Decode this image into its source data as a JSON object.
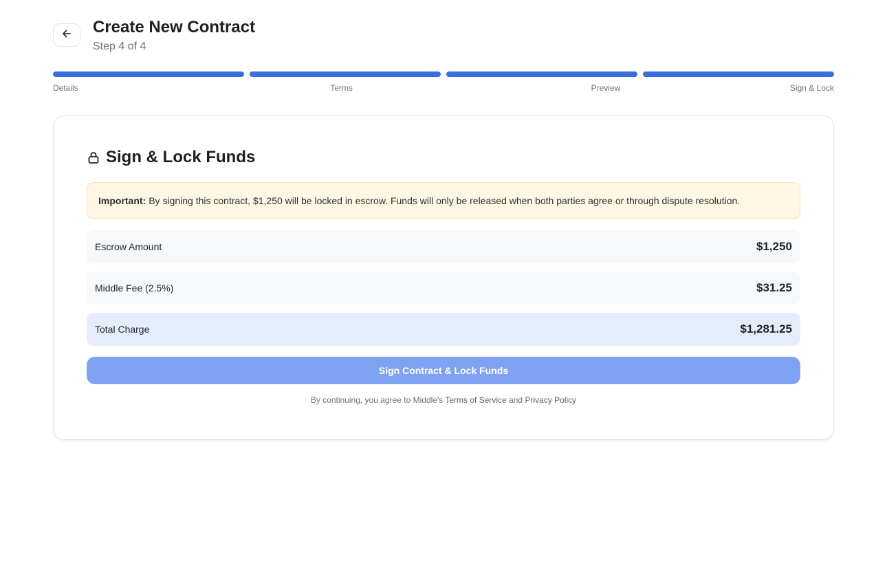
{
  "header": {
    "title": "Create New Contract",
    "subtitle": "Step 4 of 4",
    "back_icon": "arrow-left-icon"
  },
  "progress": {
    "current_step": 4,
    "total_steps": 4,
    "active_color": "#3b6fe0",
    "steps": [
      {
        "label": "Details",
        "complete": true
      },
      {
        "label": "Terms",
        "complete": true
      },
      {
        "label": "Preview",
        "complete": true
      },
      {
        "label": "Sign & Lock",
        "complete": true
      }
    ]
  },
  "card": {
    "icon": "lock-icon",
    "title": "Sign & Lock Funds",
    "notice": {
      "strong": "Important:",
      "text": "By signing this contract, $1,250 will be locked in escrow. Funds will only be released when both parties agree or through dispute resolution.",
      "background": "#fef7e3"
    },
    "rows": [
      {
        "label": "Escrow Amount",
        "value": "$1,250"
      },
      {
        "label": "Middle Fee (2.5%)",
        "value": "$31.25"
      },
      {
        "label": "Total Charge",
        "value": "$1,281.25"
      }
    ],
    "sign_button": "Sign Contract & Lock Funds",
    "sign_button_color": "#7fa3f2",
    "legal": {
      "prefix": "By continuing, you agree to Middle's",
      "terms_link": "Terms of Service",
      "and": "and",
      "privacy_link": "Privacy Policy"
    }
  }
}
